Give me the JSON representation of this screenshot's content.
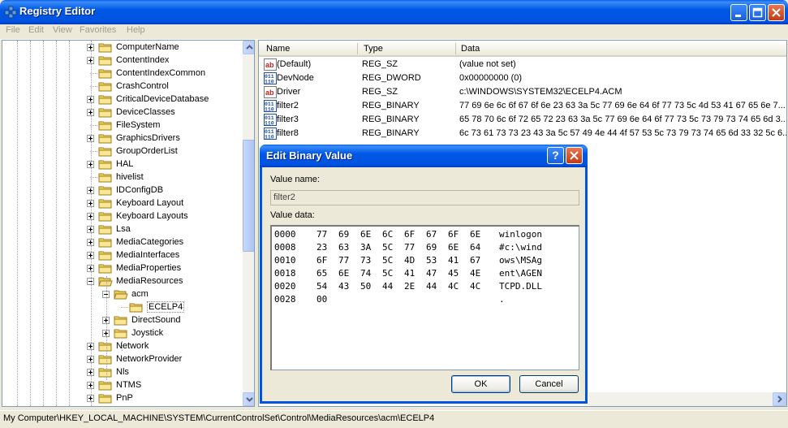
{
  "window": {
    "title": "Registry Editor"
  },
  "menu": [
    "File",
    "Edit",
    "View",
    "Favorites",
    "Help"
  ],
  "tree": [
    {
      "label": "ComputerName",
      "level": 0,
      "expander": "plus"
    },
    {
      "label": "ContentIndex",
      "level": 0,
      "expander": "plus"
    },
    {
      "label": "ContentIndexCommon",
      "level": 0,
      "expander": ""
    },
    {
      "label": "CrashControl",
      "level": 0,
      "expander": ""
    },
    {
      "label": "CriticalDeviceDatabase",
      "level": 0,
      "expander": "plus"
    },
    {
      "label": "DeviceClasses",
      "level": 0,
      "expander": "plus"
    },
    {
      "label": "FileSystem",
      "level": 0,
      "expander": ""
    },
    {
      "label": "GraphicsDrivers",
      "level": 0,
      "expander": "plus"
    },
    {
      "label": "GroupOrderList",
      "level": 0,
      "expander": ""
    },
    {
      "label": "HAL",
      "level": 0,
      "expander": "plus"
    },
    {
      "label": "hivelist",
      "level": 0,
      "expander": ""
    },
    {
      "label": "IDConfigDB",
      "level": 0,
      "expander": "plus"
    },
    {
      "label": "Keyboard Layout",
      "level": 0,
      "expander": "plus"
    },
    {
      "label": "Keyboard Layouts",
      "level": 0,
      "expander": "plus"
    },
    {
      "label": "Lsa",
      "level": 0,
      "expander": "plus"
    },
    {
      "label": "MediaCategories",
      "level": 0,
      "expander": "plus"
    },
    {
      "label": "MediaInterfaces",
      "level": 0,
      "expander": "plus"
    },
    {
      "label": "MediaProperties",
      "level": 0,
      "expander": "plus"
    },
    {
      "label": "MediaResources",
      "level": 0,
      "expander": "minus"
    },
    {
      "label": "acm",
      "level": 1,
      "expander": "minus"
    },
    {
      "label": "ECELP4",
      "level": 2,
      "expander": "",
      "selected": true
    },
    {
      "label": "DirectSound",
      "level": 1,
      "expander": "plus"
    },
    {
      "label": "Joystick",
      "level": 1,
      "expander": "plus"
    },
    {
      "label": "Network",
      "level": 0,
      "expander": "plus"
    },
    {
      "label": "NetworkProvider",
      "level": 0,
      "expander": "plus"
    },
    {
      "label": "Nls",
      "level": 0,
      "expander": "plus"
    },
    {
      "label": "NTMS",
      "level": 0,
      "expander": "plus"
    },
    {
      "label": "PnP",
      "level": 0,
      "expander": "plus"
    }
  ],
  "list": {
    "headers": {
      "name": "Name",
      "type": "Type",
      "data": "Data"
    },
    "rows": [
      {
        "icon": "string-value-icon",
        "name": "(Default)",
        "type": "REG_SZ",
        "data": "(value not set)"
      },
      {
        "icon": "binary-value-icon",
        "name": "DevNode",
        "type": "REG_DWORD",
        "data": "0x00000000 (0)"
      },
      {
        "icon": "string-value-icon",
        "name": "Driver",
        "type": "REG_SZ",
        "data": "c:\\WINDOWS\\SYSTEM32\\ECELP4.ACM"
      },
      {
        "icon": "binary-value-icon",
        "name": "filter2",
        "type": "REG_BINARY",
        "data": "77 69 6e 6c 6f 67 6f 6e 23 63 3a 5c 77 69 6e 64 6f 77 73 5c 4d 53 41 67 65 6e 7..."
      },
      {
        "icon": "binary-value-icon",
        "name": "filter3",
        "type": "REG_BINARY",
        "data": "65 78 70 6c 6f 72 65 72 23 63 3a 5c 77 69 6e 64 6f 77 73 5c 73 79 73 74 65 6d 3..."
      },
      {
        "icon": "binary-value-icon",
        "name": "filter8",
        "type": "REG_BINARY",
        "data": "6c 73 61 73 73 23 43 3a 5c 57 49 4e 44 4f 57 53 5c 73 79 73 74 65 6d 33 32 5c 6..."
      }
    ]
  },
  "status": "My Computer\\HKEY_LOCAL_MACHINE\\SYSTEM\\CurrentControlSet\\Control\\MediaResources\\acm\\ECELP4",
  "dialog": {
    "title": "Edit Binary Value",
    "help": "?",
    "value_name_label": "Value name:",
    "value_name": "filter2",
    "value_data_label": "Value data:",
    "hex_rows": [
      {
        "offset": "0000",
        "bytes": [
          "77",
          "69",
          "6E",
          "6C",
          "6F",
          "67",
          "6F",
          "6E"
        ],
        "ascii": "winlogon"
      },
      {
        "offset": "0008",
        "bytes": [
          "23",
          "63",
          "3A",
          "5C",
          "77",
          "69",
          "6E",
          "64"
        ],
        "ascii": "#c:\\wind"
      },
      {
        "offset": "0010",
        "bytes": [
          "6F",
          "77",
          "73",
          "5C",
          "4D",
          "53",
          "41",
          "67"
        ],
        "ascii": "ows\\MSAg"
      },
      {
        "offset": "0018",
        "bytes": [
          "65",
          "6E",
          "74",
          "5C",
          "41",
          "47",
          "45",
          "4E"
        ],
        "ascii": "ent\\AGEN"
      },
      {
        "offset": "0020",
        "bytes": [
          "54",
          "43",
          "50",
          "44",
          "2E",
          "44",
          "4C",
          "4C"
        ],
        "ascii": "TCPD.DLL"
      },
      {
        "offset": "0028",
        "bytes": [
          "00",
          "",
          "",
          "",
          "",
          "",
          "",
          ""
        ],
        "ascii": "."
      }
    ],
    "ok": "OK",
    "cancel": "Cancel"
  }
}
